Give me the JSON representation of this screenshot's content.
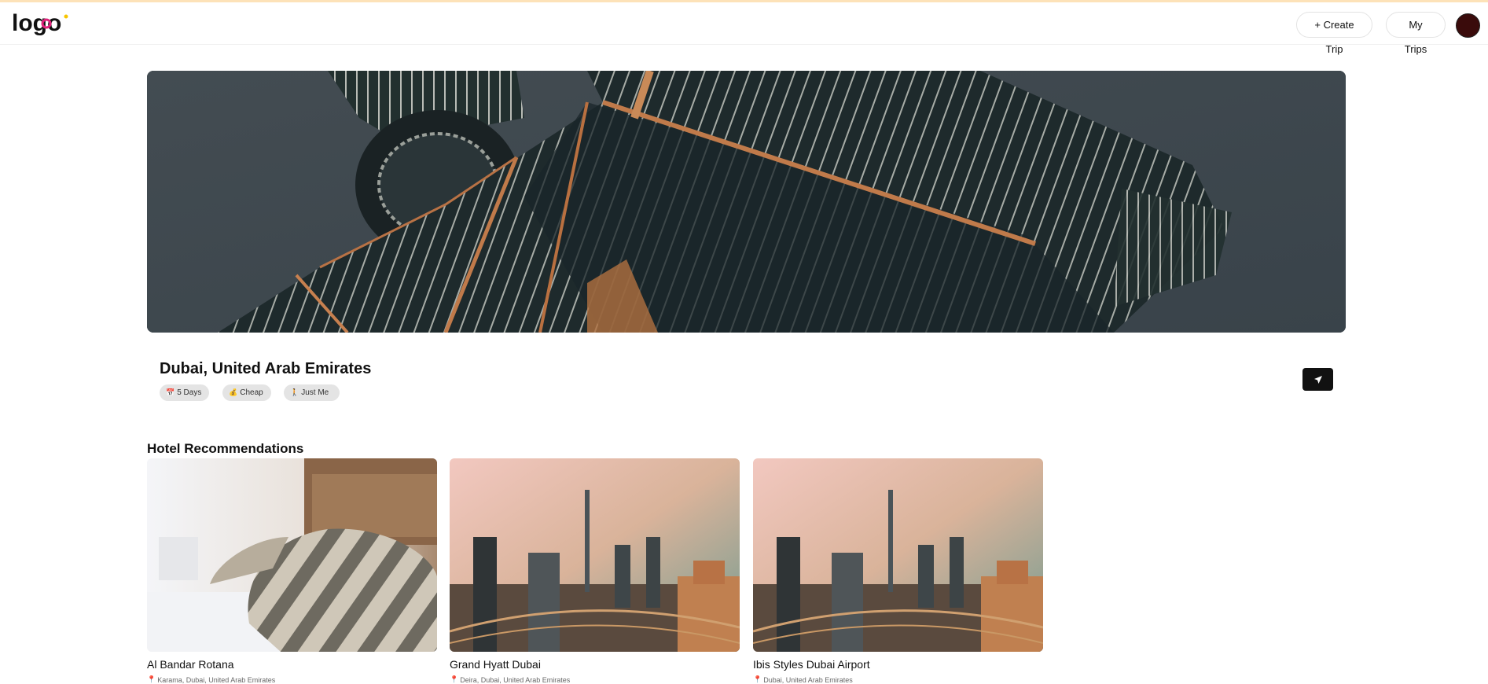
{
  "header": {
    "logo_text": "logo",
    "create_trip_label": "+ Create Trip",
    "my_trips_label": "My Trips"
  },
  "trip": {
    "destination": "Dubai, United Arab Emirates",
    "tags": [
      {
        "icon": "calendar-icon",
        "label": "5 Days"
      },
      {
        "icon": "money-bag-icon",
        "label": "Cheap"
      },
      {
        "icon": "person-icon",
        "label": "Just Me"
      }
    ]
  },
  "hotels": {
    "section_title": "Hotel Recommendations",
    "items": [
      {
        "name": "Al Bandar Rotana",
        "location": "Karama, Dubai, United Arab Emirates"
      },
      {
        "name": "Grand Hyatt Dubai",
        "location": "Deira, Dubai, United Arab Emirates"
      },
      {
        "name": "Ibis Styles Dubai Airport",
        "location": "Dubai, United Arab Emirates"
      }
    ]
  },
  "colors": {
    "top_strip": "#fde2b8",
    "share_button": "#111111",
    "tag_bg": "#e4e4e4",
    "avatar": "#3a0b0b"
  }
}
